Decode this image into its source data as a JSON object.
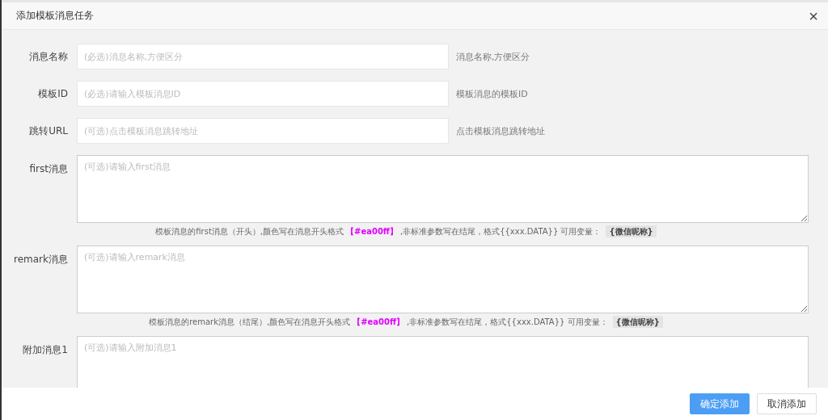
{
  "dialog": {
    "title": "添加模板消息任务",
    "close": "×"
  },
  "fields": [
    {
      "kind": "input",
      "label": "消息名称",
      "placeholder": "(必选)消息名称,方便区分",
      "help": "消息名称,方便区分"
    },
    {
      "kind": "input",
      "label": "模板ID",
      "placeholder": "(必选)请输入模板消息ID",
      "help": "模板消息的模板ID"
    },
    {
      "kind": "input",
      "label": "跳转URL",
      "placeholder": "(可选)点击模板消息跳转地址",
      "help": "点击模板消息跳转地址"
    },
    {
      "kind": "textarea",
      "label": "first消息",
      "placeholder": "(可选)请输入first消息",
      "hint": {
        "text_1": "模板消息的first消息（开头）,颜色写在消息开头格式",
        "highlight": "【#ea00ff】",
        "text_2": ",非标准参数写在结尾，格式{{xxx.DATA}} 可用变量：",
        "variable": "{微信昵称}"
      }
    },
    {
      "kind": "textarea",
      "label": "remark消息",
      "placeholder": "(可选)请输入remark消息",
      "hint": {
        "text_1": "模板消息的remark消息（结尾）,颜色写在消息开头格式",
        "highlight": "【#ea00ff】",
        "text_2": ",非标准参数写在结尾，格式{{xxx.DATA}} 可用变量：",
        "variable": "{微信昵称}"
      }
    },
    {
      "kind": "textarea",
      "label": "附加消息1",
      "placeholder": "(可选)请输入附加消息1"
    }
  ],
  "buttons": [
    {
      "label": "确定添加",
      "primary": true
    },
    {
      "label": "取消添加",
      "primary": false
    }
  ]
}
